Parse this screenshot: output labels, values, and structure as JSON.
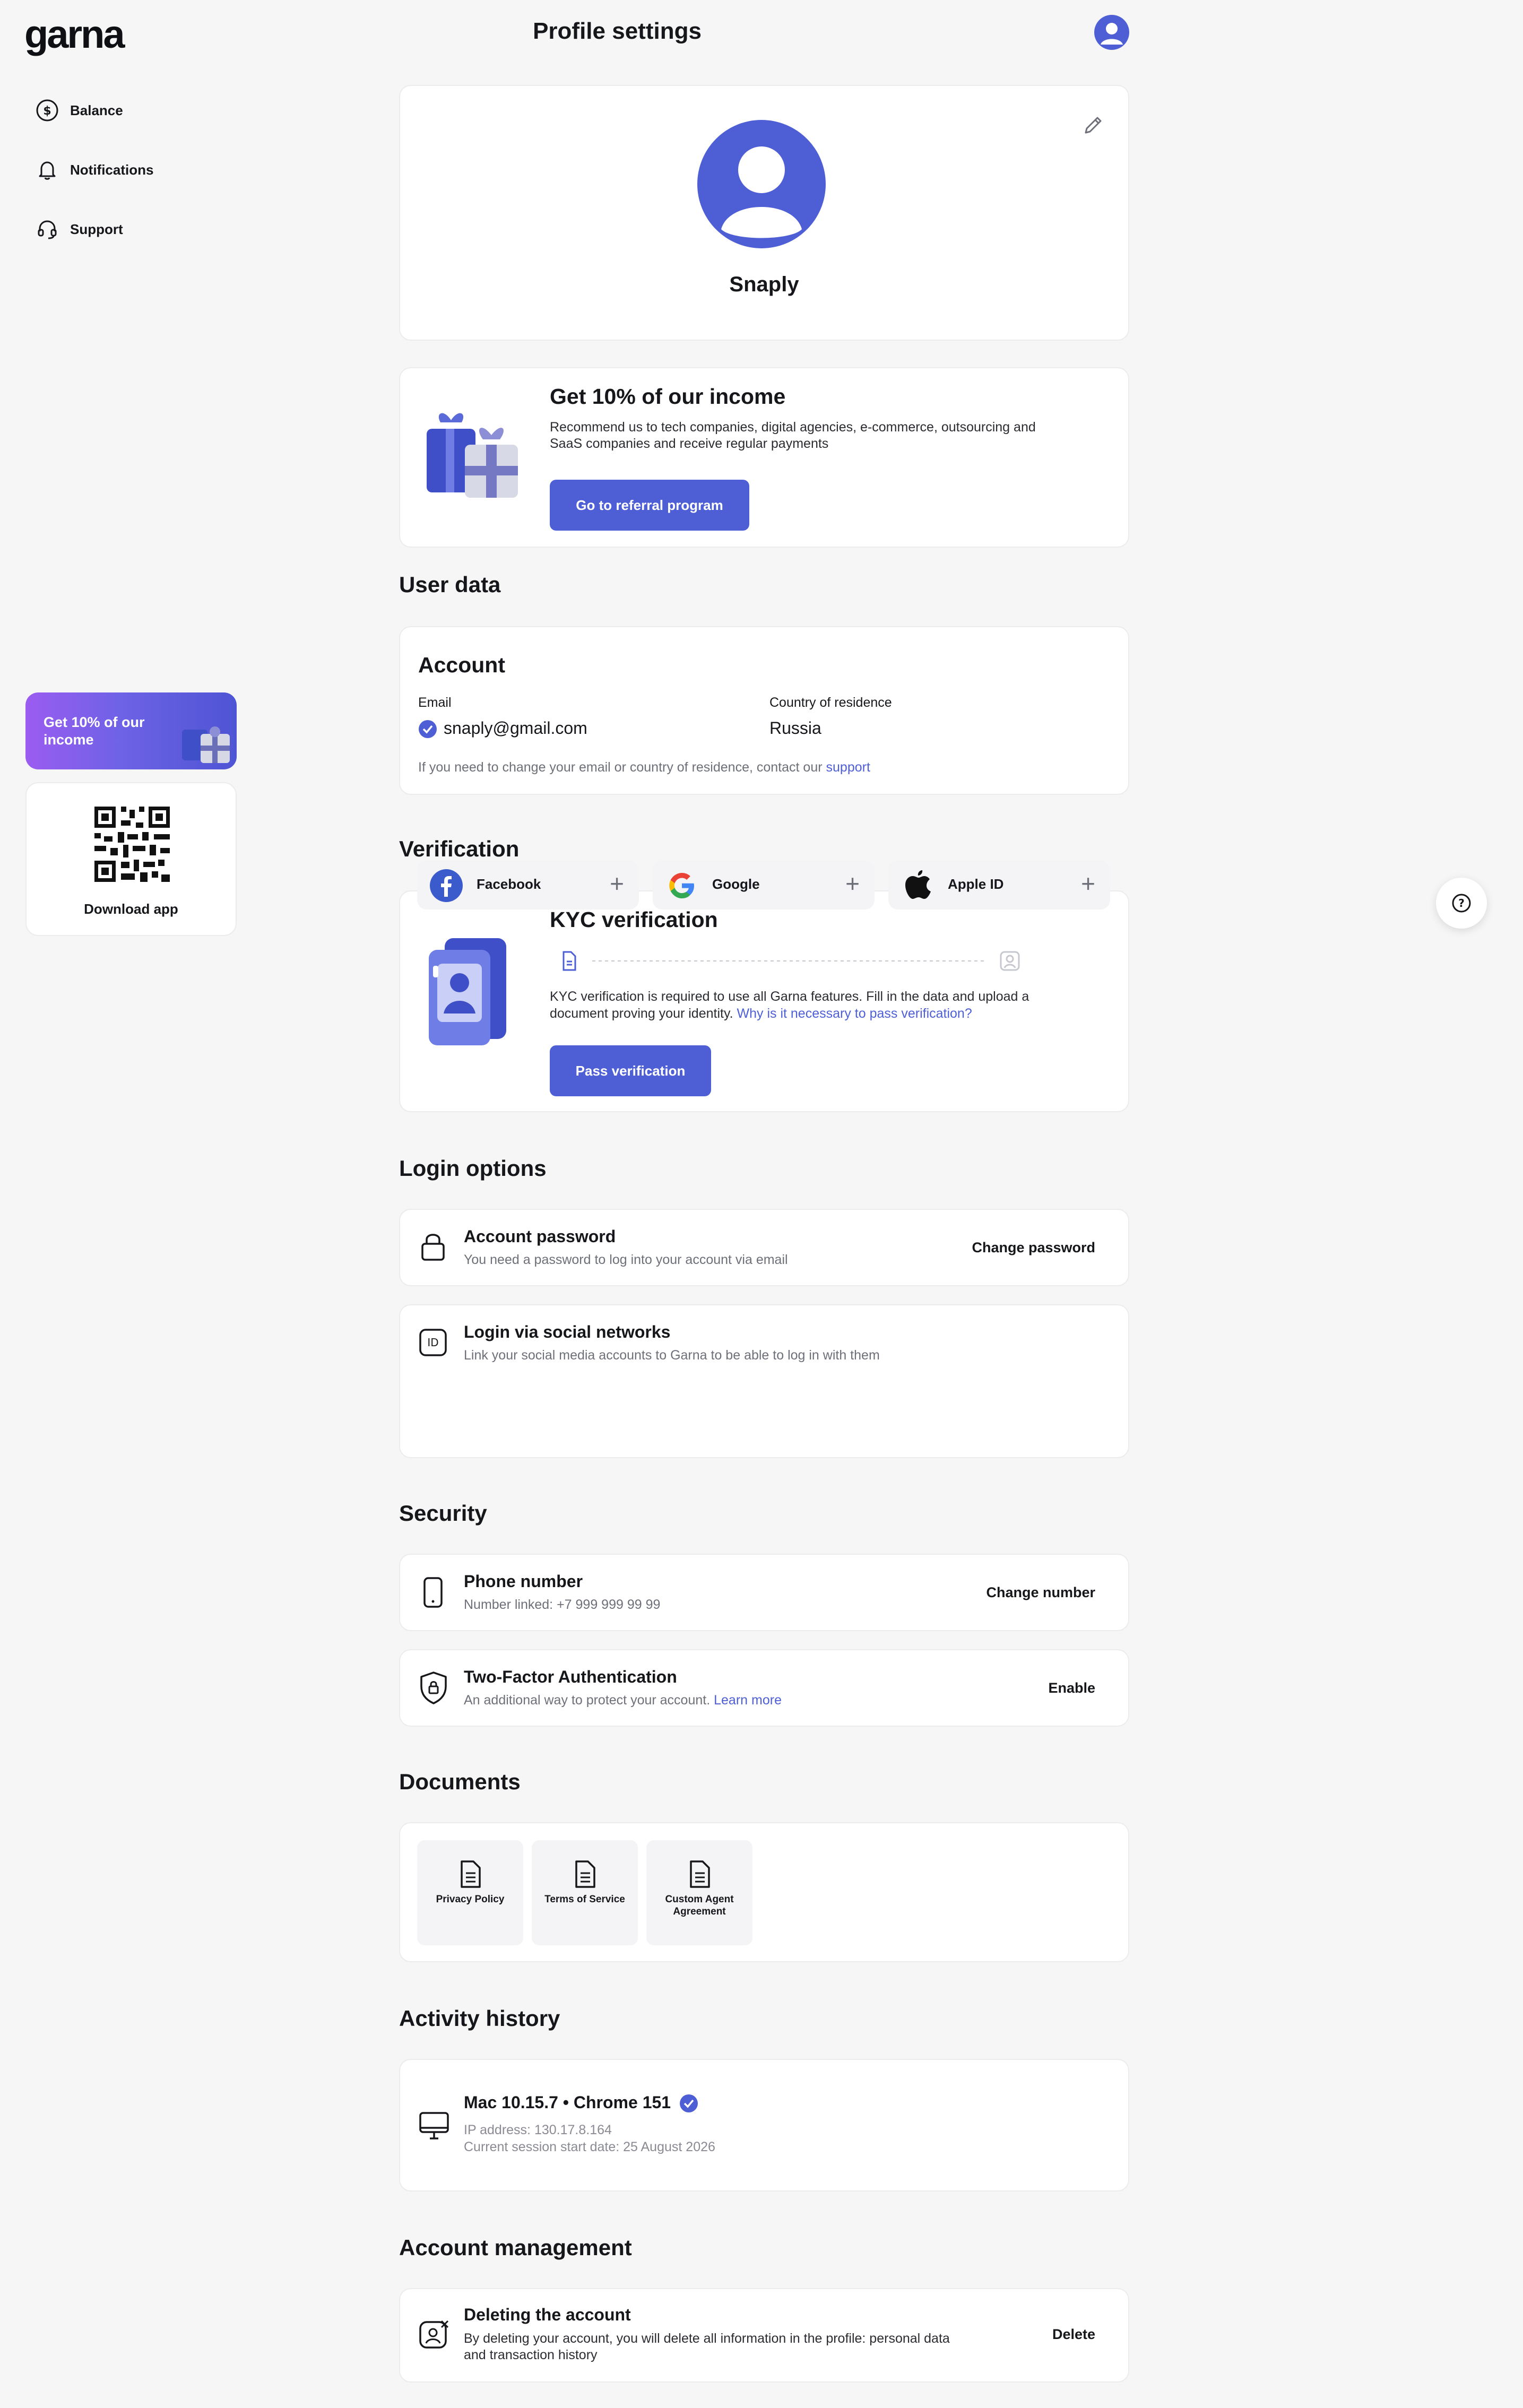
{
  "app": {
    "logo": "garna",
    "page_title": "Profile settings"
  },
  "sidebar": {
    "items": [
      {
        "label": "Balance",
        "icon": "dollar-circle-icon"
      },
      {
        "label": "Notifications",
        "icon": "bell-icon"
      },
      {
        "label": "Support",
        "icon": "headset-icon"
      }
    ],
    "promo": "Get 10% of our income",
    "download": "Download app"
  },
  "profile": {
    "name": "Snaply"
  },
  "referral": {
    "title": "Get 10% of our income",
    "desc_line1": "Recommend us to tech companies, digital agencies, e-commerce, outsourcing and",
    "desc_line2": "SaaS companies and receive regular payments",
    "button": "Go to referral program"
  },
  "user_data": {
    "section": "User data",
    "card_title": "Account",
    "email_label": "Email",
    "email_value": "snaply@gmail.com",
    "country_label": "Country of residence",
    "country_value": "Russia",
    "note": "If you need to change your email or country of residence, contact our",
    "note_link": "support"
  },
  "verification": {
    "section": "Verification",
    "title": "KYC verification",
    "desc_line1": "KYC verification is required to use all Garna features. Fill in the data and upload a",
    "desc_line2": "document proving your identity.",
    "link": "Why is it necessary to pass verification?",
    "button": "Pass verification"
  },
  "login": {
    "section": "Login options",
    "password_title": "Account password",
    "password_desc": "You need a password to log into your account via email",
    "password_action": "Change password",
    "social_title": "Login via social networks",
    "social_desc": "Link your social media accounts to Garna to be able to log in with them",
    "networks": [
      "Facebook",
      "Google",
      "Apple ID"
    ]
  },
  "security": {
    "section": "Security",
    "phone_title": "Phone number",
    "phone_desc": "Number linked: +7 999 999 99 99",
    "phone_action": "Change number",
    "tfa_title": "Two-Factor Authentication",
    "tfa_desc": "An additional way to protect your account.",
    "tfa_link": "Learn more",
    "tfa_action": "Enable"
  },
  "documents": {
    "section": "Documents",
    "items": [
      "Privacy Policy",
      "Terms of Service",
      "Custom Agent Agreement"
    ]
  },
  "activity": {
    "section": "Activity history",
    "device": "Mac 10.15.7 • Chrome 151",
    "ip": "IP address: 130.17.8.164",
    "session": "Current session start date: 25 August 2026"
  },
  "management": {
    "section": "Account management",
    "title": "Deleting the account",
    "desc_line1": "By deleting your account, you will delete all information in the profile: personal data",
    "desc_line2": "and transaction history",
    "action": "Delete"
  },
  "colors": {
    "accent": "#4e5fd6",
    "background": "#f6f6f7",
    "card": "#ffffff"
  }
}
